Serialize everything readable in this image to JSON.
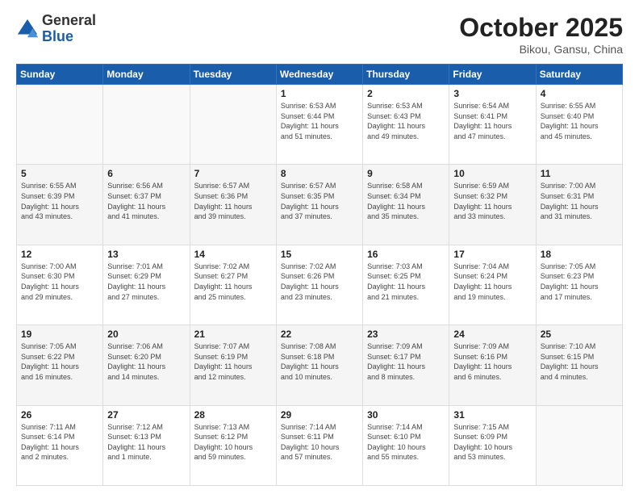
{
  "header": {
    "logo_general": "General",
    "logo_blue": "Blue",
    "title": "October 2025",
    "location": "Bikou, Gansu, China"
  },
  "days_of_week": [
    "Sunday",
    "Monday",
    "Tuesday",
    "Wednesday",
    "Thursday",
    "Friday",
    "Saturday"
  ],
  "weeks": [
    [
      {
        "day": "",
        "info": ""
      },
      {
        "day": "",
        "info": ""
      },
      {
        "day": "",
        "info": ""
      },
      {
        "day": "1",
        "info": "Sunrise: 6:53 AM\nSunset: 6:44 PM\nDaylight: 11 hours\nand 51 minutes."
      },
      {
        "day": "2",
        "info": "Sunrise: 6:53 AM\nSunset: 6:43 PM\nDaylight: 11 hours\nand 49 minutes."
      },
      {
        "day": "3",
        "info": "Sunrise: 6:54 AM\nSunset: 6:41 PM\nDaylight: 11 hours\nand 47 minutes."
      },
      {
        "day": "4",
        "info": "Sunrise: 6:55 AM\nSunset: 6:40 PM\nDaylight: 11 hours\nand 45 minutes."
      }
    ],
    [
      {
        "day": "5",
        "info": "Sunrise: 6:55 AM\nSunset: 6:39 PM\nDaylight: 11 hours\nand 43 minutes."
      },
      {
        "day": "6",
        "info": "Sunrise: 6:56 AM\nSunset: 6:37 PM\nDaylight: 11 hours\nand 41 minutes."
      },
      {
        "day": "7",
        "info": "Sunrise: 6:57 AM\nSunset: 6:36 PM\nDaylight: 11 hours\nand 39 minutes."
      },
      {
        "day": "8",
        "info": "Sunrise: 6:57 AM\nSunset: 6:35 PM\nDaylight: 11 hours\nand 37 minutes."
      },
      {
        "day": "9",
        "info": "Sunrise: 6:58 AM\nSunset: 6:34 PM\nDaylight: 11 hours\nand 35 minutes."
      },
      {
        "day": "10",
        "info": "Sunrise: 6:59 AM\nSunset: 6:32 PM\nDaylight: 11 hours\nand 33 minutes."
      },
      {
        "day": "11",
        "info": "Sunrise: 7:00 AM\nSunset: 6:31 PM\nDaylight: 11 hours\nand 31 minutes."
      }
    ],
    [
      {
        "day": "12",
        "info": "Sunrise: 7:00 AM\nSunset: 6:30 PM\nDaylight: 11 hours\nand 29 minutes."
      },
      {
        "day": "13",
        "info": "Sunrise: 7:01 AM\nSunset: 6:29 PM\nDaylight: 11 hours\nand 27 minutes."
      },
      {
        "day": "14",
        "info": "Sunrise: 7:02 AM\nSunset: 6:27 PM\nDaylight: 11 hours\nand 25 minutes."
      },
      {
        "day": "15",
        "info": "Sunrise: 7:02 AM\nSunset: 6:26 PM\nDaylight: 11 hours\nand 23 minutes."
      },
      {
        "day": "16",
        "info": "Sunrise: 7:03 AM\nSunset: 6:25 PM\nDaylight: 11 hours\nand 21 minutes."
      },
      {
        "day": "17",
        "info": "Sunrise: 7:04 AM\nSunset: 6:24 PM\nDaylight: 11 hours\nand 19 minutes."
      },
      {
        "day": "18",
        "info": "Sunrise: 7:05 AM\nSunset: 6:23 PM\nDaylight: 11 hours\nand 17 minutes."
      }
    ],
    [
      {
        "day": "19",
        "info": "Sunrise: 7:05 AM\nSunset: 6:22 PM\nDaylight: 11 hours\nand 16 minutes."
      },
      {
        "day": "20",
        "info": "Sunrise: 7:06 AM\nSunset: 6:20 PM\nDaylight: 11 hours\nand 14 minutes."
      },
      {
        "day": "21",
        "info": "Sunrise: 7:07 AM\nSunset: 6:19 PM\nDaylight: 11 hours\nand 12 minutes."
      },
      {
        "day": "22",
        "info": "Sunrise: 7:08 AM\nSunset: 6:18 PM\nDaylight: 11 hours\nand 10 minutes."
      },
      {
        "day": "23",
        "info": "Sunrise: 7:09 AM\nSunset: 6:17 PM\nDaylight: 11 hours\nand 8 minutes."
      },
      {
        "day": "24",
        "info": "Sunrise: 7:09 AM\nSunset: 6:16 PM\nDaylight: 11 hours\nand 6 minutes."
      },
      {
        "day": "25",
        "info": "Sunrise: 7:10 AM\nSunset: 6:15 PM\nDaylight: 11 hours\nand 4 minutes."
      }
    ],
    [
      {
        "day": "26",
        "info": "Sunrise: 7:11 AM\nSunset: 6:14 PM\nDaylight: 11 hours\nand 2 minutes."
      },
      {
        "day": "27",
        "info": "Sunrise: 7:12 AM\nSunset: 6:13 PM\nDaylight: 11 hours\nand 1 minute."
      },
      {
        "day": "28",
        "info": "Sunrise: 7:13 AM\nSunset: 6:12 PM\nDaylight: 10 hours\nand 59 minutes."
      },
      {
        "day": "29",
        "info": "Sunrise: 7:14 AM\nSunset: 6:11 PM\nDaylight: 10 hours\nand 57 minutes."
      },
      {
        "day": "30",
        "info": "Sunrise: 7:14 AM\nSunset: 6:10 PM\nDaylight: 10 hours\nand 55 minutes."
      },
      {
        "day": "31",
        "info": "Sunrise: 7:15 AM\nSunset: 6:09 PM\nDaylight: 10 hours\nand 53 minutes."
      },
      {
        "day": "",
        "info": ""
      }
    ]
  ]
}
